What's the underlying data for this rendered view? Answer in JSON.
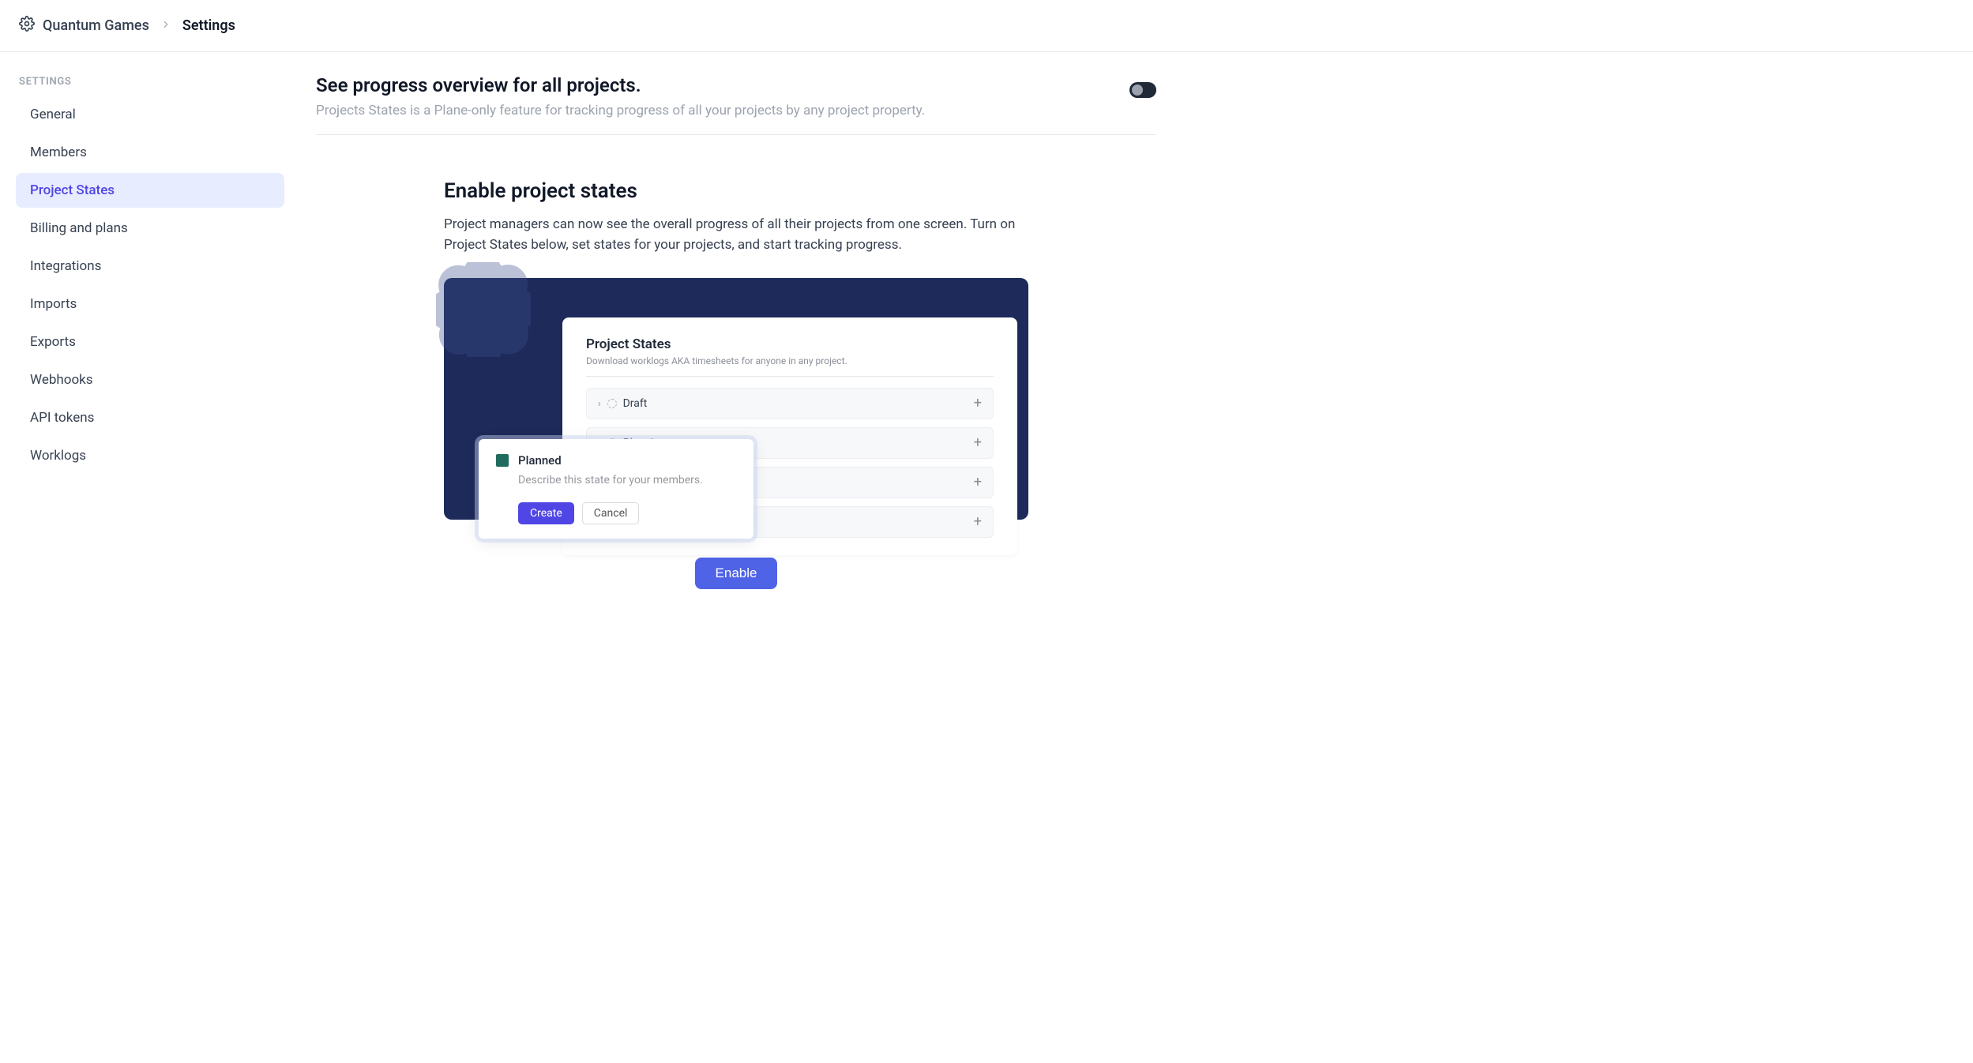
{
  "breadcrumb": {
    "org": "Quantum Games",
    "page": "Settings"
  },
  "sidebar": {
    "section_label": "SETTINGS",
    "items": [
      {
        "label": "General",
        "active": false
      },
      {
        "label": "Members",
        "active": false
      },
      {
        "label": "Project States",
        "active": true
      },
      {
        "label": "Billing and plans",
        "active": false
      },
      {
        "label": "Integrations",
        "active": false
      },
      {
        "label": "Imports",
        "active": false
      },
      {
        "label": "Exports",
        "active": false
      },
      {
        "label": "Webhooks",
        "active": false
      },
      {
        "label": "API tokens",
        "active": false
      },
      {
        "label": "Worklogs",
        "active": false
      }
    ]
  },
  "header": {
    "title": "See progress overview for all projects.",
    "subtitle": "Projects States is a Plane-only feature for tracking progress of all your projects by any project property."
  },
  "feature_toggle": {
    "enabled": false
  },
  "content": {
    "title": "Enable project states",
    "description": "Project managers can now see the overall progress of all their projects from one screen. Turn on Project States below, set states for your projects, and start tracking progress."
  },
  "illustration": {
    "panel_title": "Project States",
    "panel_subtitle": "Download worklogs AKA timesheets for anyone in any project.",
    "states": [
      {
        "label": "Draft"
      },
      {
        "label": "Planning"
      },
      {
        "label": ""
      },
      {
        "label": ""
      }
    ],
    "popup": {
      "state_name": "Planned",
      "placeholder": "Describe this state for your members.",
      "create_label": "Create",
      "cancel_label": "Cancel",
      "swatch_color": "#1f6b5e"
    }
  },
  "enable_button": "Enable"
}
